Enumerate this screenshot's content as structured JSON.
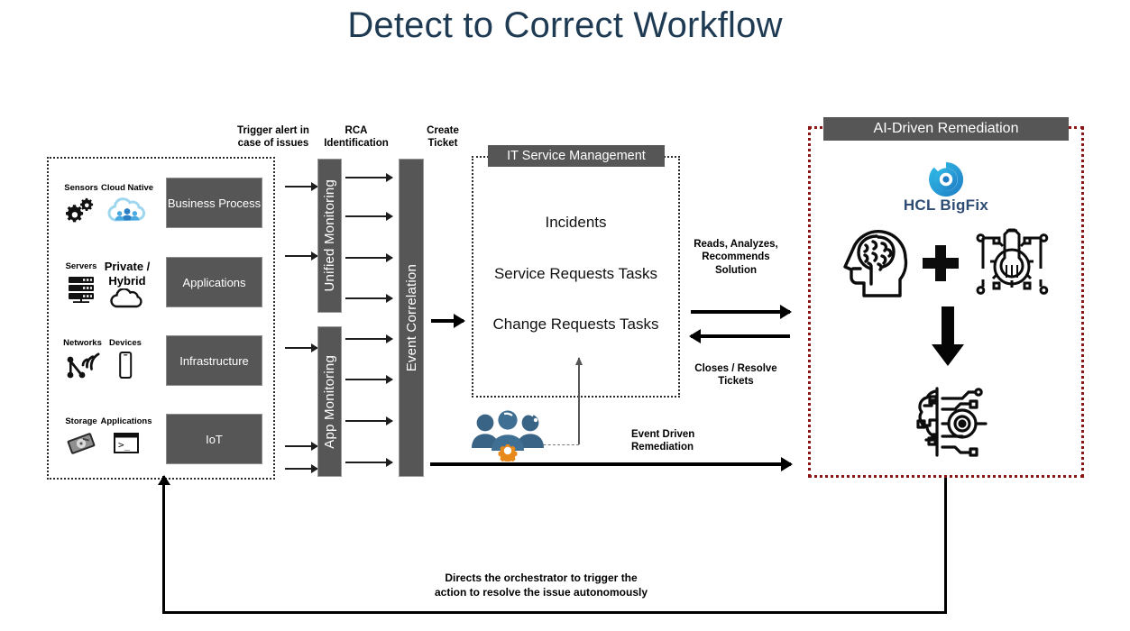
{
  "title": "Detect to Correct Workflow",
  "theme": {
    "title_color": "#1F3B53",
    "box_gray": "#565656",
    "ai_border_red": "#8C1616",
    "bigfix_blue": "#2E4B73",
    "gear_orange": "#E8891B",
    "people_blue": "#3A6486"
  },
  "source_panel": {
    "name": "source-systems",
    "rows": [
      {
        "icons": [
          {
            "caption": "Sensors",
            "icon": "gears-icon"
          },
          {
            "caption": "Cloud Native",
            "icon": "cloud-people-icon"
          }
        ],
        "box_label": "Business Process"
      },
      {
        "icons": [
          {
            "caption": "Servers",
            "icon": "server-rack-icon"
          },
          {
            "caption": "Private /\nHybrid",
            "icon": "cloud-outline-icon"
          }
        ],
        "box_label": "Applications"
      },
      {
        "icons": [
          {
            "caption": "Networks",
            "icon": "network-signal-icon"
          },
          {
            "caption": "Devices",
            "icon": "mobile-device-icon"
          }
        ],
        "box_label": "Infrastructure"
      },
      {
        "icons": [
          {
            "caption": "Storage",
            "icon": "hard-disk-icon"
          },
          {
            "caption": "Applications",
            "icon": "terminal-window-icon"
          }
        ],
        "box_label": "IoT"
      }
    ],
    "row_captions": {
      "servers_private": "Private /",
      "servers_hybrid": "Hybrid"
    }
  },
  "flow_labels": {
    "trigger_line1": "Trigger alert in",
    "trigger_line2": "case of issues",
    "rca_line1": "RCA",
    "rca_line2": "Identification",
    "create_line1": "Create",
    "create_line2": "Ticket",
    "reads_line1": "Reads, Analyzes,",
    "reads_line2": "Recommends",
    "reads_line3": "Solution",
    "closes_line1": "Closes / Resolve",
    "closes_line2": "Tickets",
    "event_driven_line1": "Event Driven",
    "event_driven_line2": "Remediation",
    "bottom_line1": "Directs the orchestrator to trigger the",
    "bottom_line2": "action to resolve the issue autonomously"
  },
  "vertical_bars": {
    "unified_monitoring": "Unified Monitoring",
    "app_monitoring": "App Monitoring",
    "event_correlation": "Event Correlation"
  },
  "itsm": {
    "header": "IT Service Management",
    "items": [
      "Incidents",
      "Service Requests Tasks",
      "Change Requests Tasks"
    ]
  },
  "ai_panel": {
    "header": "AI-Driven Remediation",
    "product": "HCL BigFix",
    "icons": [
      {
        "name": "bigfix-logo-icon"
      },
      {
        "name": "head-brain-icon"
      },
      {
        "name": "plus-icon"
      },
      {
        "name": "gear-wrench-tech-icon"
      },
      {
        "name": "down-arrow-icon"
      },
      {
        "name": "ai-circuit-brain-icon"
      }
    ]
  },
  "orchestrator": {
    "icon": "people-gear-icon"
  }
}
